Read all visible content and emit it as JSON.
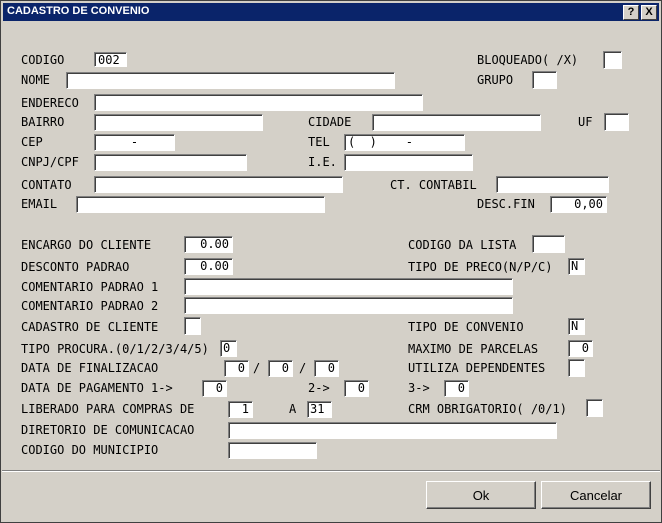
{
  "window": {
    "title": "CADASTRO DE CONVENIO",
    "help_button": "?",
    "close_button": "X"
  },
  "form": {
    "codigo": {
      "label": "CODIGO",
      "value": "002"
    },
    "bloqueado": {
      "label": "BLOQUEADO( /X)",
      "value": ""
    },
    "nome": {
      "label": "NOME",
      "value": ""
    },
    "grupo": {
      "label": "GRUPO",
      "value": ""
    },
    "endereco": {
      "label": "ENDERECO",
      "value": ""
    },
    "bairro": {
      "label": "BAIRRO",
      "value": ""
    },
    "cidade": {
      "label": "CIDADE",
      "value": ""
    },
    "uf": {
      "label": "UF",
      "value": ""
    },
    "cep": {
      "label": "CEP",
      "value": "-"
    },
    "tel": {
      "label": "TEL",
      "value": "(  )    -"
    },
    "cnpj": {
      "label": "CNPJ/CPF",
      "value": ""
    },
    "ie": {
      "label": "I.E.",
      "value": ""
    },
    "contato": {
      "label": "CONTATO",
      "value": ""
    },
    "ct_contabil": {
      "label": "CT. CONTABIL",
      "value": ""
    },
    "email": {
      "label": "EMAIL",
      "value": ""
    },
    "desc_fin": {
      "label": "DESC.FIN",
      "value": "0,00"
    },
    "encargo": {
      "label": "ENCARGO DO CLIENTE",
      "value": "0.00"
    },
    "codigo_lista": {
      "label": "CODIGO DA LISTA",
      "value": ""
    },
    "desconto": {
      "label": "DESCONTO PADRAO",
      "value": "0.00"
    },
    "tipo_preco": {
      "label": "TIPO DE PRECO(N/P/C)",
      "value": "N"
    },
    "comentario1": {
      "label": "COMENTARIO PADRAO 1",
      "value": ""
    },
    "comentario2": {
      "label": "COMENTARIO PADRAO 2",
      "value": ""
    },
    "cadastro_cliente": {
      "label": "CADASTRO DE CLIENTE",
      "value": ""
    },
    "tipo_convenio": {
      "label": "TIPO DE CONVENIO",
      "value": "N"
    },
    "tipo_procura": {
      "label": "TIPO PROCURA.(0/1/2/3/4/5)",
      "value": "0"
    },
    "max_parcelas": {
      "label": "MAXIMO DE PARCELAS",
      "value": "0"
    },
    "data_final": {
      "label": "DATA DE FINALIZACAO",
      "day": "0",
      "month": "0",
      "year": "0",
      "sep": "/"
    },
    "utiliza_dep": {
      "label": "UTILIZA DEPENDENTES",
      "value": ""
    },
    "data_pag": {
      "label": "DATA DE PAGAMENTO 1->",
      "v1": "0",
      "label2": "2->",
      "v2": "0",
      "label3": "3->",
      "v3": "0"
    },
    "liberado": {
      "label": "LIBERADO PARA COMPRAS DE",
      "from": "1",
      "sep": "A",
      "to": "31"
    },
    "crm": {
      "label": "CRM OBRIGATORIO( /0/1)",
      "value": ""
    },
    "diretorio": {
      "label": "DIRETORIO DE COMUNICACAO",
      "value": ""
    },
    "municipio": {
      "label": "CODIGO DO MUNICIPIO",
      "value": ""
    }
  },
  "buttons": {
    "ok": "Ok",
    "cancel": "Cancelar"
  }
}
